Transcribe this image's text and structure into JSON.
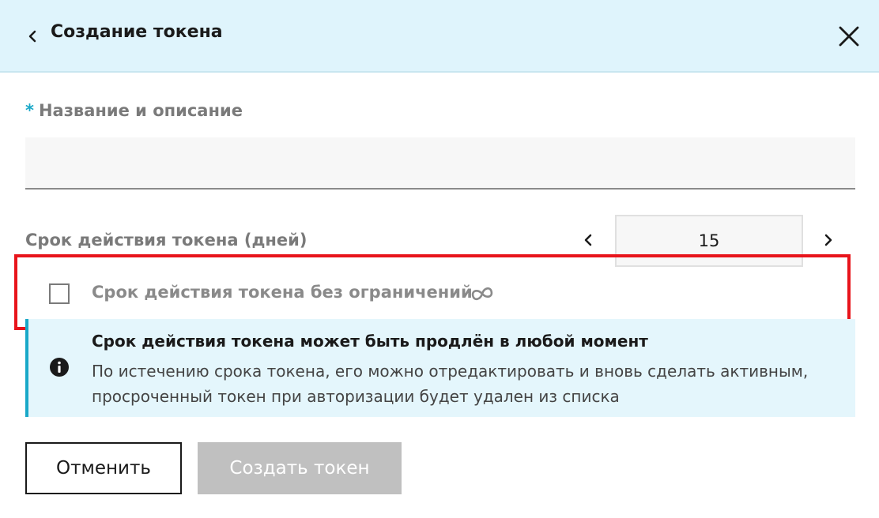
{
  "header": {
    "back_icon": "chevron-left-icon",
    "title": "Создание токена",
    "close_icon": "close-icon"
  },
  "name_field": {
    "required_mark": "*",
    "label": "Название и описание",
    "value": "",
    "placeholder": ""
  },
  "lifetime": {
    "label": "Срок действия токена (дней)",
    "value": "15",
    "prev_icon": "chevron-left-icon",
    "next_icon": "chevron-right-icon"
  },
  "unlimited": {
    "label": "Срок действия токена без ограничений",
    "checked": false,
    "icon": "infinity-icon"
  },
  "info": {
    "icon": "info-icon",
    "title": "Срок действия токена может быть продлён в любой момент",
    "text": "По истечению срока токена, его можно отредактировать и вновь сделать активным, просроченный токен при авторизации будет удален из списка"
  },
  "actions": {
    "cancel_label": "Отменить",
    "create_label": "Создать токен"
  },
  "colors": {
    "header_bg": "#dff4fc",
    "accent": "#19a8c8",
    "highlight": "#e8141b",
    "disabled_button": "#c0c0c0"
  }
}
